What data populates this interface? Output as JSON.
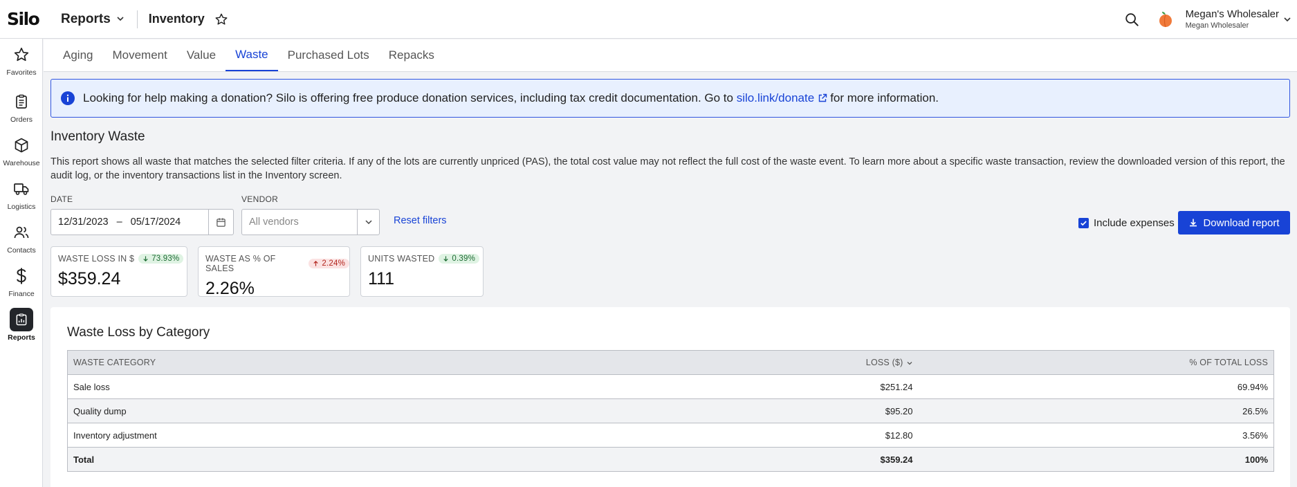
{
  "app": {
    "logo": "Silo",
    "section": "Reports",
    "breadcrumb": "Inventory",
    "account_name": "Megan's Wholesaler",
    "account_sub": "Megan Wholesaler"
  },
  "sidebar": {
    "items": [
      {
        "label": "Favorites",
        "icon": "star-icon"
      },
      {
        "label": "Orders",
        "icon": "clipboard-icon"
      },
      {
        "label": "Warehouse",
        "icon": "box-icon"
      },
      {
        "label": "Logistics",
        "icon": "truck-icon"
      },
      {
        "label": "Contacts",
        "icon": "people-icon"
      },
      {
        "label": "Finance",
        "icon": "dollar-icon"
      },
      {
        "label": "Reports",
        "icon": "report-icon",
        "active": true
      }
    ]
  },
  "tabs": [
    {
      "label": "Aging"
    },
    {
      "label": "Movement"
    },
    {
      "label": "Value"
    },
    {
      "label": "Waste",
      "active": true
    },
    {
      "label": "Purchased Lots"
    },
    {
      "label": "Repacks"
    }
  ],
  "banner": {
    "text_before": "Looking for help making a donation? Silo is offering free produce donation services, including tax credit documentation. Go to",
    "link": "silo.link/donate",
    "text_after": "for more information."
  },
  "page": {
    "title": "Inventory Waste",
    "description": "This report shows all waste that matches the selected filter criteria. If any of the lots are currently unpriced (PAS), the total cost value may not reflect the full cost of the waste event. To learn more about a specific waste transaction, review the downloaded version of this report, the audit log, or the inventory transactions list in the Inventory screen."
  },
  "filters": {
    "date_label": "DATE",
    "date_start": "12/31/2023",
    "date_separator": "–",
    "date_end": "05/17/2024",
    "vendor_label": "VENDOR",
    "vendor_placeholder": "All vendors",
    "reset_label": "Reset filters",
    "include_expenses_label": "Include expenses",
    "include_expenses_checked": true,
    "download_label": "Download report"
  },
  "kpis": [
    {
      "label": "WASTE LOSS IN $",
      "change": "73.93%",
      "direction": "down",
      "value": "$359.24"
    },
    {
      "label": "WASTE AS % OF SALES",
      "change": "2.24%",
      "direction": "up",
      "value": "2.26%"
    },
    {
      "label": "UNITS WASTED",
      "change": "0.39%",
      "direction": "down",
      "value": "111"
    }
  ],
  "table": {
    "title": "Waste Loss by Category",
    "headers": [
      "WASTE CATEGORY",
      "LOSS ($)",
      "% OF TOTAL LOSS"
    ],
    "rows": [
      [
        "Sale loss",
        "$251.24",
        "69.94%"
      ],
      [
        "Quality dump",
        "$95.20",
        "26.5%"
      ],
      [
        "Inventory adjustment",
        "$12.80",
        "3.56%"
      ]
    ],
    "total": [
      "Total",
      "$359.24",
      "100%"
    ]
  },
  "colors": {
    "accent": "#1843d6",
    "banner_bg": "#e8f0fe",
    "badge_down_bg": "#dff3e3",
    "badge_up_bg": "#fbe2e2"
  }
}
